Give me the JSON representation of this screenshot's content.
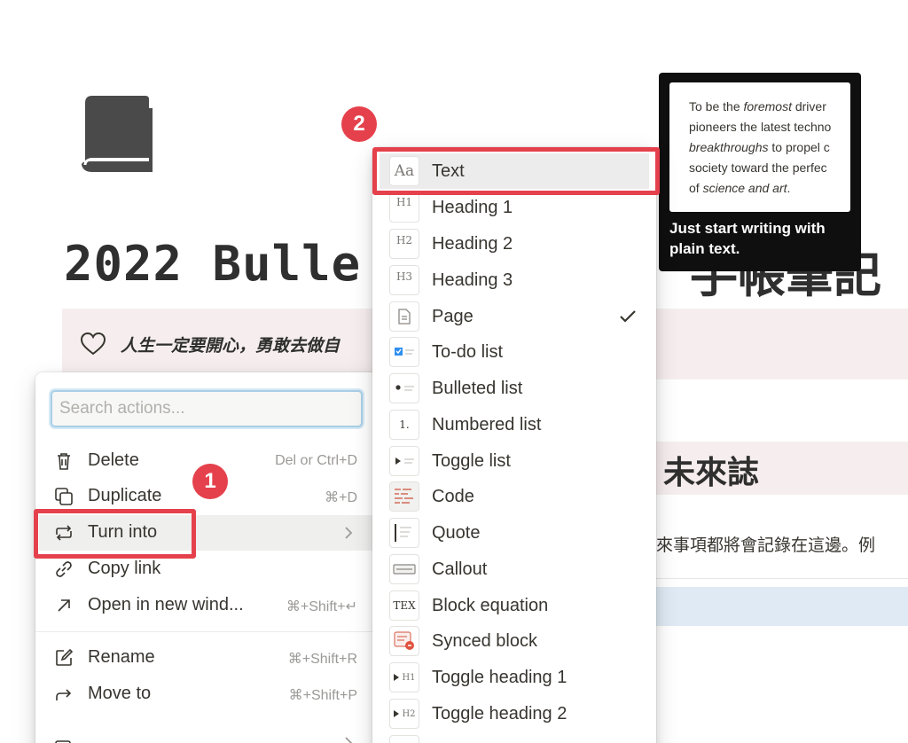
{
  "page": {
    "title": "2022 Bulle",
    "title_tail": "手帳筆記",
    "callout_text": "人生一定要開心，勇敢去做自",
    "heading_partial": "未來誌",
    "body_partial": "來事項都將會記錄在這邊。例",
    "icon": "book-icon"
  },
  "action_menu": {
    "search_placeholder": "Search actions...",
    "items": [
      {
        "label": "Delete",
        "shortcut": "Del or Ctrl+D",
        "icon": "trash-icon"
      },
      {
        "label": "Duplicate",
        "shortcut": "⌘+D",
        "icon": "duplicate-icon"
      },
      {
        "label": "Turn into",
        "shortcut": "",
        "icon": "turn-into-icon"
      },
      {
        "label": "Copy link",
        "shortcut": "",
        "icon": "link-icon"
      },
      {
        "label": "Open in new wind...",
        "shortcut": "⌘+Shift+↵",
        "icon": "open-external-icon"
      },
      {
        "label": "Rename",
        "shortcut": "⌘+Shift+R",
        "icon": "rename-icon"
      },
      {
        "label": "Move to",
        "shortcut": "⌘+Shift+P",
        "icon": "move-arrow-icon"
      }
    ]
  },
  "turn_into_menu": {
    "items": [
      {
        "label": "Text",
        "icon": "text-aa-icon",
        "glyph": "Aa"
      },
      {
        "label": "Heading 1",
        "icon": "heading1-icon",
        "glyph": "H1"
      },
      {
        "label": "Heading 2",
        "icon": "heading2-icon",
        "glyph": "H2"
      },
      {
        "label": "Heading 3",
        "icon": "heading3-icon",
        "glyph": "H3"
      },
      {
        "label": "Page",
        "icon": "page-icon",
        "glyph": "",
        "checked": true
      },
      {
        "label": "To-do list",
        "icon": "todo-icon",
        "glyph": ""
      },
      {
        "label": "Bulleted list",
        "icon": "bullet-list-icon",
        "glyph": ""
      },
      {
        "label": "Numbered list",
        "icon": "numbered-list-icon",
        "glyph": "1."
      },
      {
        "label": "Toggle list",
        "icon": "toggle-list-icon",
        "glyph": ""
      },
      {
        "label": "Code",
        "icon": "code-icon",
        "glyph": ""
      },
      {
        "label": "Quote",
        "icon": "quote-icon",
        "glyph": ""
      },
      {
        "label": "Callout",
        "icon": "callout-icon",
        "glyph": ""
      },
      {
        "label": "Block equation",
        "icon": "equation-icon",
        "glyph": "TEX"
      },
      {
        "label": "Synced block",
        "icon": "synced-block-icon",
        "glyph": ""
      },
      {
        "label": "Toggle heading 1",
        "icon": "toggle-heading1-icon",
        "glyph": "H1"
      },
      {
        "label": "Toggle heading 2",
        "icon": "toggle-heading2-icon",
        "glyph": "H2"
      }
    ]
  },
  "tooltip": {
    "preview_lines": [
      "To be the",
      "foremost",
      "driver",
      "pioneers the latest techno",
      "breakthroughs",
      "to propel c",
      "society toward the perfec",
      "of",
      "science and art",
      "."
    ],
    "caption": "Just start writing with plain text."
  },
  "annotations": {
    "step1": "1",
    "step2": "2",
    "color": "#e5414c"
  }
}
